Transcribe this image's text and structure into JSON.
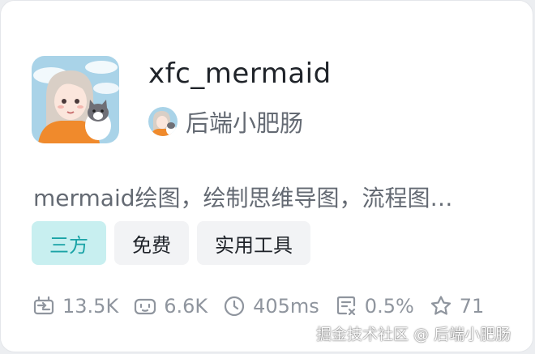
{
  "card": {
    "title": "xfc_mermaid",
    "author": "后端小肥肠",
    "description": "mermaid绘图，绘制思维导图，流程图…",
    "tags": [
      {
        "label": "三方",
        "accent": true
      },
      {
        "label": "免费",
        "accent": false
      },
      {
        "label": "实用工具",
        "accent": false
      }
    ],
    "stats": [
      {
        "icon": "plugin-usage-icon",
        "value": "13.5K"
      },
      {
        "icon": "bot-icon",
        "value": "6.6K"
      },
      {
        "icon": "clock-icon",
        "value": "405ms"
      },
      {
        "icon": "error-rate-icon",
        "value": "0.5%"
      },
      {
        "icon": "star-icon",
        "value": "71"
      }
    ]
  },
  "watermark": "掘金技术社区 @ 后端小肥肠",
  "colors": {
    "accent_tag_bg": "#c8eff0",
    "accent_tag_text": "#1aa3a6",
    "title": "#1f2329",
    "secondary_text": "#646a73",
    "stat_text": "#8f959e"
  }
}
